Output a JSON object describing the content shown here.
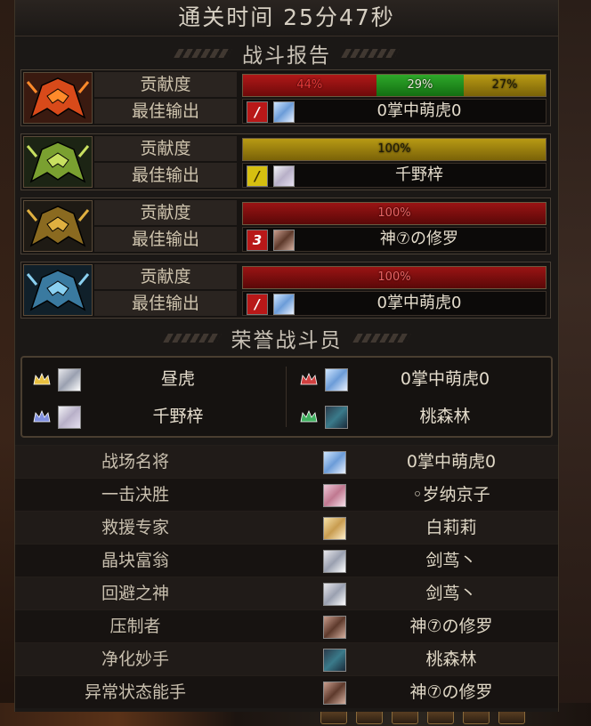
{
  "title": "通关时间   25分47秒",
  "battle_report": {
    "heading": "战斗报告",
    "contribution_label": "贡献度",
    "best_output_label": "最佳输出",
    "bosses": [
      {
        "segments": [
          {
            "percent": "44%",
            "color": "red",
            "share": 44
          },
          {
            "percent": "29%",
            "color": "green",
            "share": 29
          },
          {
            "percent": "27%",
            "color": "gold",
            "share": 27
          }
        ],
        "best_badge": "/",
        "best_badge_color": "#b81818",
        "best_player": "0掌中萌虎0",
        "best_avatar": "av-blue"
      },
      {
        "segments": [
          {
            "percent": "100%",
            "color": "gold",
            "share": 100
          }
        ],
        "best_badge": "/",
        "best_badge_color": "#d6bf10",
        "best_player": "千野梓",
        "best_avatar": "av-white"
      },
      {
        "segments": [
          {
            "percent": "100%",
            "color": "dred",
            "share": 100
          }
        ],
        "best_badge": "3",
        "best_badge_color": "#b81818",
        "best_player": "神⑦の修罗",
        "best_avatar": "av-brown"
      },
      {
        "segments": [
          {
            "percent": "100%",
            "color": "dred",
            "share": 100
          }
        ],
        "best_badge": "/",
        "best_badge_color": "#b81818",
        "best_player": "0掌中萌虎0",
        "best_avatar": "av-blue"
      }
    ]
  },
  "honor": {
    "heading": "荣誉战斗员",
    "members": [
      {
        "name": "昼虎",
        "crown_color": "#e8c040",
        "avatar": "av-silver"
      },
      {
        "name": "0掌中萌虎0",
        "crown_color": "#d04040",
        "avatar": "av-blue"
      },
      {
        "name": "千野梓",
        "crown_color": "#8090e0",
        "avatar": "av-white"
      },
      {
        "name": "桃森林",
        "crown_color": "#40b060",
        "avatar": "av-teal"
      }
    ]
  },
  "awards": [
    {
      "title": "战场名将",
      "player": "0掌中萌虎0",
      "avatar": "av-blue"
    },
    {
      "title": "一击决胜",
      "player": "◦岁纳京子",
      "avatar": "av-pink"
    },
    {
      "title": "救援专家",
      "player": "白莉莉",
      "avatar": "av-blonde"
    },
    {
      "title": "晶块富翁",
      "player": "剑茑丶",
      "avatar": "av-silver"
    },
    {
      "title": "回避之神",
      "player": "剑茑丶",
      "avatar": "av-silver"
    },
    {
      "title": "压制者",
      "player": "神⑦の修罗",
      "avatar": "av-brown"
    },
    {
      "title": "净化妙手",
      "player": "桃森林",
      "avatar": "av-teal"
    },
    {
      "title": "异常状态能手",
      "player": "神⑦の修罗",
      "avatar": "av-brown"
    }
  ]
}
